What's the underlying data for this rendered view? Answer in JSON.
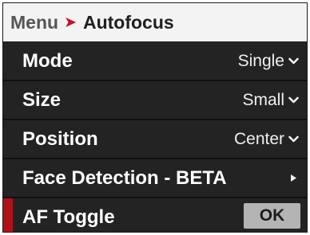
{
  "header": {
    "root": "Menu",
    "separator": "➤",
    "current": "Autofocus"
  },
  "rows": [
    {
      "label": "Mode",
      "value": "Single",
      "indicator": "chevron-down-icon"
    },
    {
      "label": "Size",
      "value": "Small",
      "indicator": "chevron-down-icon"
    },
    {
      "label": "Position",
      "value": "Center",
      "indicator": "chevron-down-icon"
    },
    {
      "label": "Face Detection - BETA",
      "value": "",
      "indicator": "chevron-right-icon"
    },
    {
      "label": "AF Toggle",
      "button": "OK",
      "selected": true
    }
  ],
  "colors": {
    "accent": "#c8102e",
    "selection": "#b11116",
    "background": "#232323",
    "header_bg": "#f3f3f3",
    "button_bg": "#b4b4b4"
  }
}
